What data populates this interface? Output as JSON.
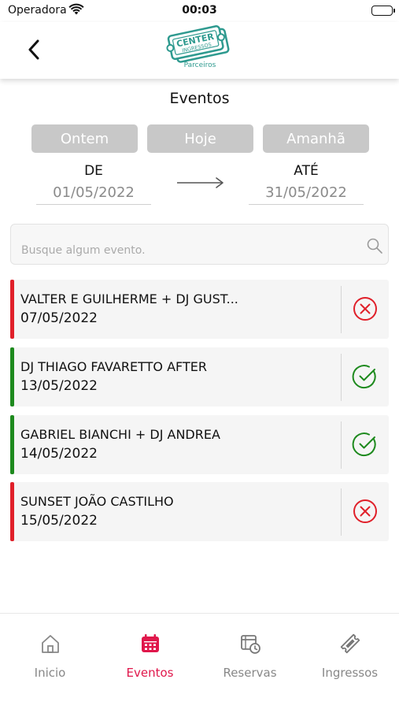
{
  "status_bar": {
    "carrier": "Operadora",
    "time": "00:03"
  },
  "header": {
    "logo_text": "CENTER",
    "logo_sub_text": "INGRESSOS",
    "logo_caption": "Parceiros"
  },
  "page": {
    "title": "Eventos"
  },
  "day_filters": [
    {
      "label": "Ontem"
    },
    {
      "label": "Hoje"
    },
    {
      "label": "Amanhã"
    }
  ],
  "date_range": {
    "from_label": "DE",
    "from_value": "01/05/2022",
    "to_label": "ATÉ",
    "to_value": "31/05/2022"
  },
  "search": {
    "placeholder": "Busque algum evento."
  },
  "events": [
    {
      "name": "VALTER E GUILHERME + DJ GUST...",
      "date": "07/05/2022",
      "status": "inactive",
      "status_icon": "x-circle-icon"
    },
    {
      "name": "DJ THIAGO FAVARETTO AFTER",
      "date": "13/05/2022",
      "status": "active",
      "status_icon": "check-circle-icon"
    },
    {
      "name": "GABRIEL BIANCHI + DJ ANDREA",
      "date": "14/05/2022",
      "status": "active",
      "status_icon": "check-circle-icon"
    },
    {
      "name": "SUNSET JOÃO CASTILHO",
      "date": "15/05/2022",
      "status": "inactive",
      "status_icon": "x-circle-icon"
    }
  ],
  "tabs": [
    {
      "label": "Inicio",
      "icon": "home-icon",
      "active": false
    },
    {
      "label": "Eventos",
      "icon": "calendar-icon",
      "active": true
    },
    {
      "label": "Reservas",
      "icon": "reservation-icon",
      "active": false
    },
    {
      "label": "Ingressos",
      "icon": "ticket-icon",
      "active": false
    }
  ],
  "colors": {
    "accent": "#e0174b",
    "active_status": "#1e8a1e",
    "inactive_status": "#e0202a",
    "day_button_bg": "#c8c8c8",
    "logo": "#2e9a8f"
  }
}
